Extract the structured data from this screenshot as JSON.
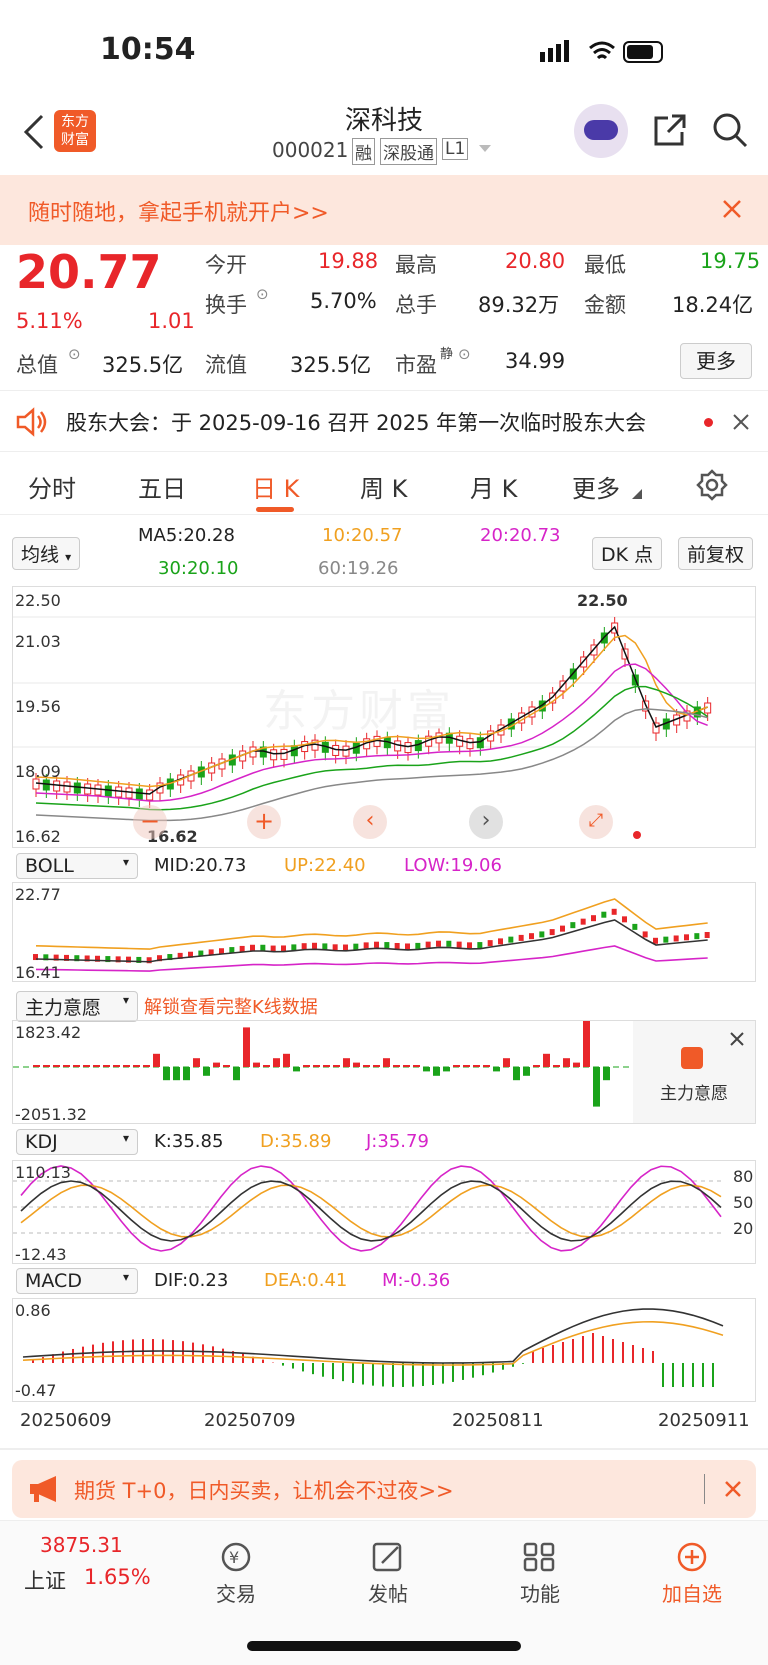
{
  "status": {
    "time": "10:54"
  },
  "header": {
    "logo": "东方\n财富",
    "title": "深科技",
    "code": "000021",
    "tags": [
      "融",
      "深股通",
      "L1"
    ]
  },
  "banner": {
    "text": "随时随地，拿起手机就开户>>"
  },
  "quote": {
    "price": "20.77",
    "pct": "5.11%",
    "chg": "1.01",
    "open_label": "今开",
    "open": "19.88",
    "high_label": "最高",
    "high": "20.80",
    "low_label": "最低",
    "low": "19.75",
    "turnover_label": "换手",
    "turnover": "5.70%",
    "volume_label": "总手",
    "volume": "89.32万",
    "amount_label": "金额",
    "amount": "18.24亿",
    "mktcap_label": "总值",
    "mktcap": "325.5亿",
    "float_label": "流值",
    "float": "325.5亿",
    "pe_label": "市盈",
    "pe_sup": "静",
    "pe": "34.99",
    "more": "更多"
  },
  "notice": {
    "text": "股东大会：于 2025-09-16 召开 2025 年第一次临时股东大会"
  },
  "tabs": [
    "分时",
    "五日",
    "日 K",
    "周 K",
    "月 K",
    "更多"
  ],
  "ma": {
    "selector": "均线",
    "ma5": "MA5:20.28",
    "ma10": "10:20.57",
    "ma20": "20:20.73",
    "ma30": "30:20.10",
    "ma60": "60:19.26",
    "dk": "DK 点",
    "adjust": "前复权"
  },
  "kline": {
    "y_labels": [
      "22.50",
      "21.03",
      "19.56",
      "18.09",
      "16.62"
    ],
    "max_label": "22.50",
    "min_label": "16.62",
    "watermark": "东方财富"
  },
  "boll": {
    "selector": "BOLL",
    "mid": "MID:20.73",
    "up": "UP:22.40",
    "low": "LOW:19.06",
    "y_top": "22.77",
    "y_bottom": "16.41"
  },
  "zlyy": {
    "selector": "主力意愿",
    "unlock": "解锁查看完整K线数据",
    "y_top": "1823.42",
    "y_bottom": "-2051.32",
    "side_label": "主力意愿"
  },
  "kdj": {
    "selector": "KDJ",
    "k": "K:35.85",
    "d": "D:35.89",
    "j": "J:35.79",
    "y_top": "110.13",
    "y_bottom": "-12.43",
    "right": [
      "80",
      "50",
      "20"
    ]
  },
  "macd": {
    "selector": "MACD",
    "dif": "DIF:0.23",
    "dea": "DEA:0.41",
    "m": "M:-0.36",
    "y_top": "0.86",
    "y_bottom": "-0.47"
  },
  "dates": [
    "20250609",
    "20250709",
    "20250811",
    "20250911"
  ],
  "ad": {
    "text": "期货 T+0，日内买卖，让机会不过夜>>"
  },
  "nav": {
    "index_value": "3875.31",
    "index_name": "上证",
    "index_pct": "1.65%",
    "items": [
      "交易",
      "发帖",
      "功能",
      "加自选"
    ]
  },
  "colors": {
    "up": "#e8262a",
    "down": "#1aa31a",
    "accent": "#f05a28",
    "banner_bg": "#fde7dd"
  }
}
